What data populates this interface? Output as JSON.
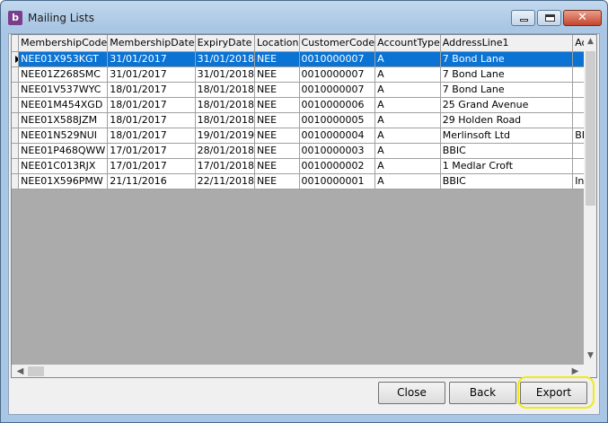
{
  "window": {
    "title": "Mailing Lists",
    "icon": "app-icon",
    "icon_letter": "b"
  },
  "grid": {
    "columns": [
      "MembershipCode",
      "MembershipDate",
      "ExpiryDate",
      "Location",
      "CustomerCode",
      "AccountType",
      "AddressLine1",
      "Ac"
    ],
    "rows": [
      [
        "NEE01X953KGT",
        "31/01/2017",
        "31/01/2018",
        "NEE",
        "0010000007",
        "A",
        "7 Bond Lane",
        ""
      ],
      [
        "NEE01Z268SMC",
        "31/01/2017",
        "31/01/2018",
        "NEE",
        "0010000007",
        "A",
        "7 Bond Lane",
        ""
      ],
      [
        "NEE01V537WYC",
        "18/01/2017",
        "18/01/2018",
        "NEE",
        "0010000007",
        "A",
        "7 Bond Lane",
        ""
      ],
      [
        "NEE01M454XGD",
        "18/01/2017",
        "18/01/2018",
        "NEE",
        "0010000006",
        "A",
        "25 Grand Avenue",
        ""
      ],
      [
        "NEE01X588JZM",
        "18/01/2017",
        "18/01/2018",
        "NEE",
        "0010000005",
        "A",
        "29 Holden Road",
        ""
      ],
      [
        "NEE01N529NUI",
        "18/01/2017",
        "19/01/2019",
        "NEE",
        "0010000004",
        "A",
        "Merlinsoft Ltd",
        "BB"
      ],
      [
        "NEE01P468QWW",
        "17/01/2017",
        "28/01/2018",
        "NEE",
        "0010000003",
        "A",
        "BBIC",
        ""
      ],
      [
        "NEE01C013RJX",
        "17/01/2017",
        "17/01/2018",
        "NEE",
        "0010000002",
        "A",
        "1 Medlar Croft",
        ""
      ],
      [
        "NEE01X596PMW",
        "21/11/2016",
        "22/11/2018",
        "NEE",
        "0010000001",
        "A",
        "BBIC",
        "Inn"
      ]
    ],
    "selected_row": 0
  },
  "buttons": {
    "close": "Close",
    "back": "Back",
    "export": "Export"
  },
  "colors": {
    "selection": "#0a73d4",
    "highlight": "#f2ea18"
  }
}
